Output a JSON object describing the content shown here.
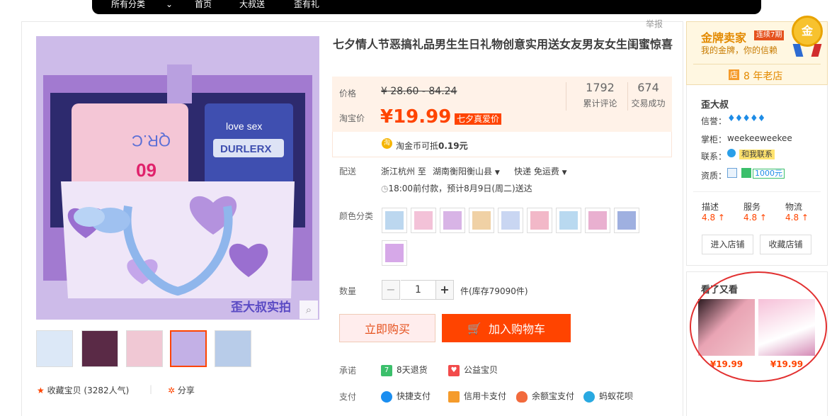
{
  "topbar": {
    "nav": [
      "所有分类",
      "首页",
      "大叔送",
      "歪有礼"
    ]
  },
  "report_link": "举报",
  "product": {
    "title": "七夕情人节恶搞礼品男生生日礼物创意实用送女友男友女生闺蜜惊喜",
    "image_watermark": "歪大叔实拍"
  },
  "price": {
    "label": "价格",
    "original": "¥ 28.60 - 84.24",
    "taobao_label": "淘宝价",
    "current": "¥19.99",
    "promo_tag": "七夕真爱价",
    "reviews_count": "1792",
    "reviews_label": "累计评论",
    "deals_count": "674",
    "deals_label": "交易成功",
    "coin_text": "淘金币可抵",
    "coin_amount": "0.19元"
  },
  "delivery": {
    "label": "配送",
    "from": "浙江杭州 至",
    "to": "湖南衡阳衡山县",
    "method": "快递 免运费",
    "eta": "18:00前付款，预计8月9日(周二)送达"
  },
  "options": {
    "label": "颜色分类",
    "swatch_colors": [
      "#bcd7ef",
      "#f3c2d8",
      "#d8b4e6",
      "#f0d1a5",
      "#c9d6f2",
      "#f2b8c8",
      "#b9d9f0",
      "#e9b0d0",
      "#9fb0e0",
      "#d6a8e8"
    ]
  },
  "quantity": {
    "label": "数量",
    "value": "1",
    "minus": "−",
    "plus": "+",
    "stock": "件(库存79090件)"
  },
  "actions": {
    "buy_now": "立即购买",
    "add_cart": "加入购物车"
  },
  "promise": {
    "label": "承诺",
    "items": [
      "8天退货",
      "公益宝贝"
    ]
  },
  "payment": {
    "label": "支付",
    "items": [
      "快捷支付",
      "信用卡支付",
      "余额宝支付",
      "蚂蚁花呗"
    ]
  },
  "favorite": {
    "text": "收藏宝贝 (3282人气)",
    "share": "分享"
  },
  "seller": {
    "badge_title": "金牌卖家",
    "badge_streak": "连续7期",
    "badge_sub": "我的金牌，你的信赖",
    "medal_char": "金",
    "store_tag": "店",
    "store_age": "8 年老店",
    "name": "歪大叔",
    "credit_label": "信誉：",
    "keeper_label": "掌柜：",
    "keeper_name": "weekeeweekee",
    "contact_label": "联系：",
    "contact_text": "和我联系",
    "qual_label": "资质：",
    "qual_amount": "1000元",
    "ratings": [
      {
        "label": "描述",
        "value": "4.8 ↑"
      },
      {
        "label": "服务",
        "value": "4.8 ↑"
      },
      {
        "label": "物流",
        "value": "4.8 ↑"
      }
    ],
    "enter_store": "进入店铺",
    "fav_store": "收藏店铺"
  },
  "also_viewed": {
    "title": "看了又看",
    "items": [
      {
        "price": "¥19.99"
      },
      {
        "price": "¥19.99"
      }
    ]
  }
}
